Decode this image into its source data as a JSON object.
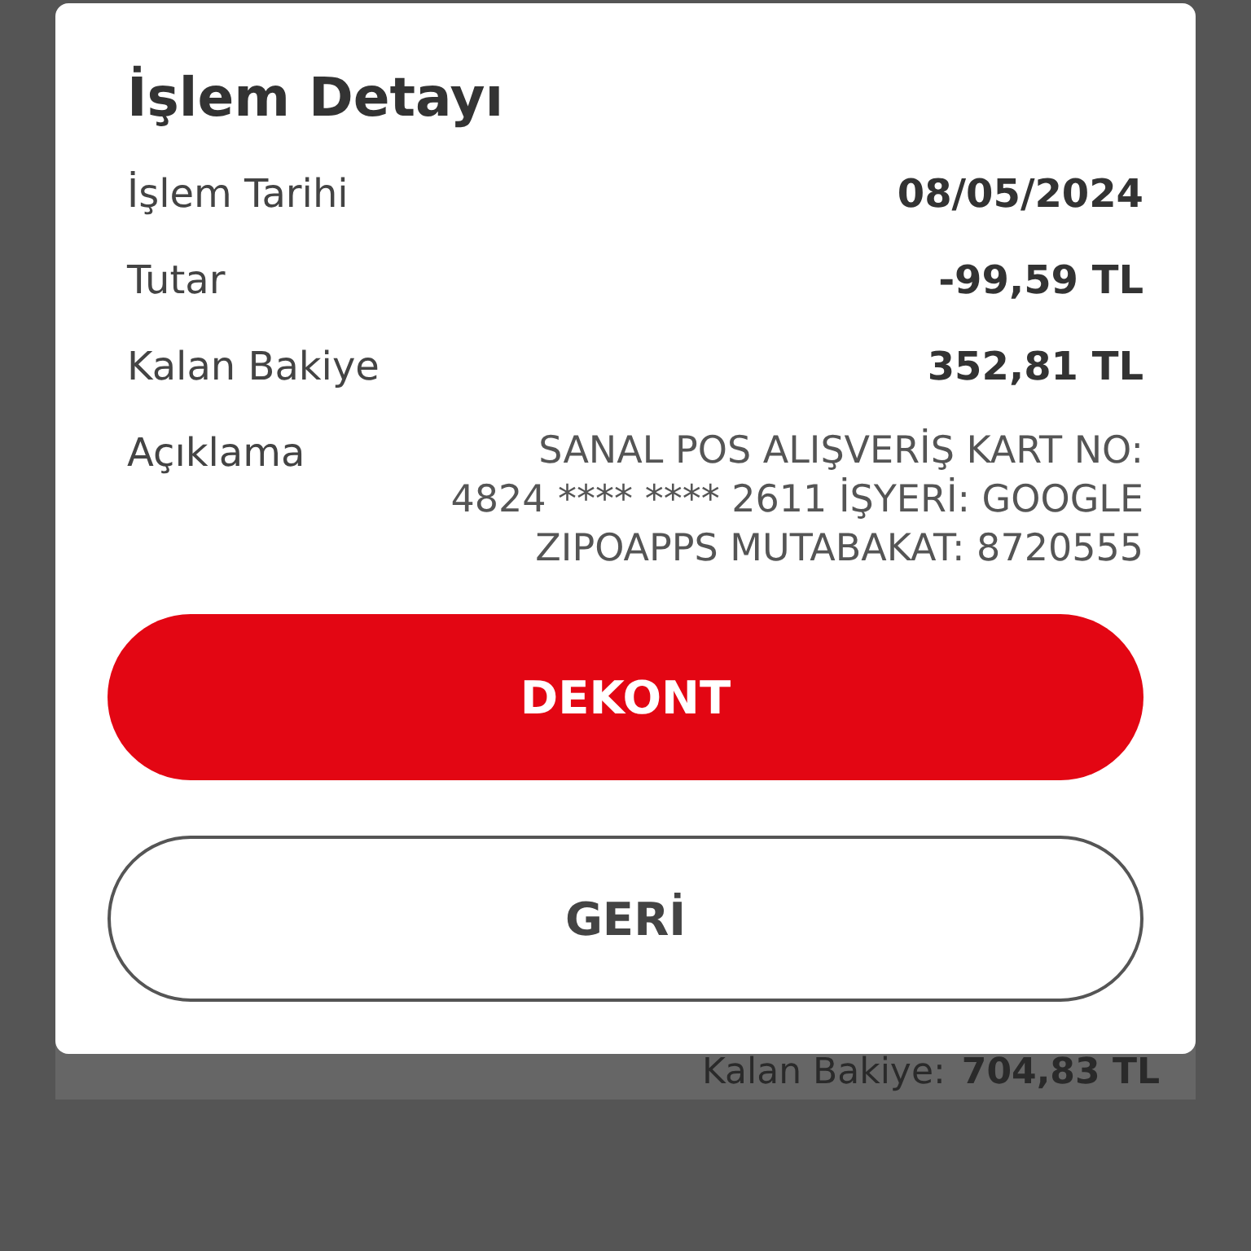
{
  "dialog": {
    "title": "İşlem Detayı",
    "rows": [
      {
        "label": "İşlem Tarihi",
        "value": "08/05/2024",
        "kind": "bold"
      },
      {
        "label": "Tutar",
        "value": "-99,59 TL",
        "kind": "bold"
      },
      {
        "label": "Kalan Bakiye",
        "value": "352,81 TL",
        "kind": "bold"
      },
      {
        "label": "Açıklama",
        "value_lines": [
          "SANAL POS ALIŞVERİŞ KART NO:",
          "4824 **** **** 2611 İŞYERİ: GOOGLE",
          "ZIPOAPPS  MUTABAKAT: 8720555"
        ],
        "kind": "plain"
      }
    ],
    "buttons": [
      {
        "label": "DEKONT",
        "kind": "primary"
      },
      {
        "label": "GERİ",
        "kind": "outline"
      }
    ]
  },
  "background": {
    "label": "Kalan Bakiye:",
    "value": "704,83 TL"
  }
}
